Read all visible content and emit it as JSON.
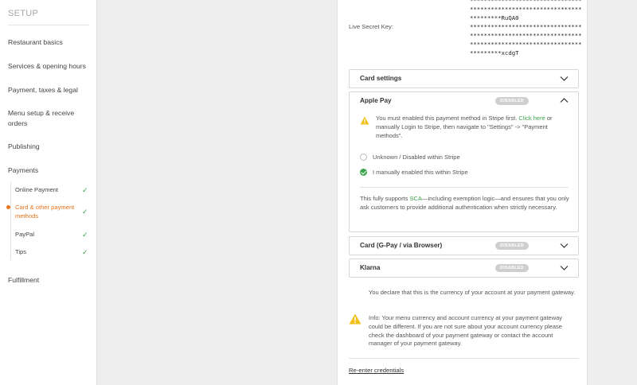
{
  "sidebar": {
    "title": "SETUP",
    "items": [
      {
        "label": "Restaurant basics"
      },
      {
        "label": "Services & opening hours"
      },
      {
        "label": "Payment, taxes & legal"
      },
      {
        "label": "Menu setup & receive orders"
      },
      {
        "label": "Publishing"
      },
      {
        "label": "Payments"
      },
      {
        "label": "Fulfillment"
      }
    ],
    "sub_items": [
      {
        "label": "Online Payment",
        "check": "✓"
      },
      {
        "label": "Card & other payment methods",
        "check": "✓"
      },
      {
        "label": "PayPal",
        "check": "✓"
      },
      {
        "label": "Tips",
        "check": "✓"
      }
    ]
  },
  "credentials": {
    "key_top_line1": "********************************",
    "key_top_line2": "********************************",
    "key_top_line3": "*********RuQA0",
    "live_secret_label": "Live Secret Key:",
    "live_secret_line1": "********************************",
    "live_secret_line2": "********************************",
    "live_secret_line3": "********************************",
    "live_secret_line4": "*********xcdgT"
  },
  "card_settings": {
    "title": "Card settings"
  },
  "apple_pay": {
    "title": "Apple Pay",
    "badge": "DISABLED",
    "warning_pre": "You must enabled this payment method in Stripe first.",
    "warning_link": "Click here",
    "warning_post": "or manually Login to Stripe, then navigate to \"Settings\" -> \"Payment methods\".",
    "option_unknown": "Unknown / Disabled within Stripe",
    "option_manual": "I manually enabled this within Stripe",
    "sca_pre": "This fully supports",
    "sca_link": "SCA",
    "sca_post": "—including exemption logic—and ensures that you only ask customers to provide additional authentication when strictly necessary."
  },
  "gpay": {
    "title": "Card (G-Pay / via Browser)",
    "badge": "DISABLED"
  },
  "klarna": {
    "title": "Klarna",
    "badge": "DISABLED"
  },
  "currency": {
    "declare_text": "You declare that this is the currency of your account at your payment gateway.",
    "info_text": "Info: Your menu currency and account currency at your payment gateway could be different. If you are not sure about your account currency please check the dashboard of your payment gateway or contact the account manager of your payment gateway."
  },
  "reenter_label": "Re-enter credentials",
  "colors": {
    "accent": "#e8731c",
    "success": "#3fa34d",
    "warning": "#f2c21b",
    "badge": "#cfcfcf"
  }
}
